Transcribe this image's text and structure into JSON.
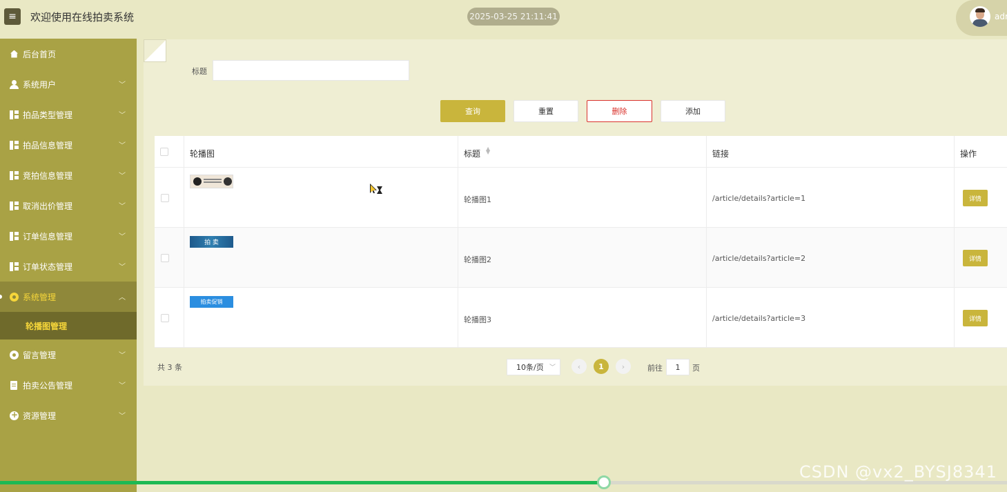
{
  "header": {
    "menu_icon": "hamburger-icon",
    "title": "欢迎使用在线拍卖系统",
    "datetime": "2025-03-25 21:11:41",
    "user_name": "adr"
  },
  "sidebar": {
    "items": [
      {
        "label": "后台首页",
        "icon": "home-icon"
      },
      {
        "label": "系统用户",
        "icon": "user-icon"
      },
      {
        "label": "拍品类型管理",
        "icon": "grid-icon"
      },
      {
        "label": "拍品信息管理",
        "icon": "grid-icon"
      },
      {
        "label": "竞拍信息管理",
        "icon": "grid-icon"
      },
      {
        "label": "取消出价管理",
        "icon": "grid-icon"
      },
      {
        "label": "订单信息管理",
        "icon": "grid-icon"
      },
      {
        "label": "订单状态管理",
        "icon": "grid-icon"
      },
      {
        "label": "系统管理",
        "icon": "gear-icon"
      },
      {
        "label": "留言管理",
        "icon": "flower-icon"
      },
      {
        "label": "拍卖公告管理",
        "icon": "document-icon"
      },
      {
        "label": "资源管理",
        "icon": "plus-circle-icon"
      }
    ],
    "active_sub": "轮播图管理"
  },
  "filter": {
    "title_label": "标题",
    "title_value": "",
    "title_placeholder": ""
  },
  "toolbar": {
    "query": "查询",
    "reset": "重置",
    "delete": "删除",
    "add": "添加"
  },
  "table": {
    "columns": [
      "轮播图",
      "标题",
      "链接",
      "操作"
    ],
    "rows": [
      {
        "title": "轮播图1",
        "link": "/article/details?article=1",
        "action": "详情",
        "thumb_text": ""
      },
      {
        "title": "轮播图2",
        "link": "/article/details?article=2",
        "action": "详情",
        "thumb_text": "拍 卖"
      },
      {
        "title": "轮播图3",
        "link": "/article/details?article=3",
        "action": "详情",
        "thumb_text": "拍卖促销"
      }
    ]
  },
  "pagination": {
    "total": "共 3 条",
    "page_size": "10条/页",
    "current_page": "1",
    "goto_label": "前往",
    "goto_value": "1",
    "goto_unit": "页"
  },
  "video": {
    "progress": 0.6
  },
  "watermark": "CSDN @vx2_BYSJ8341",
  "colors": {
    "accent": "#c9b53c",
    "sidebar": "#a9a245",
    "background": "#e9e8c4",
    "danger": "#d9302a",
    "active_text": "#f6d63a",
    "progress": "#1db954"
  }
}
